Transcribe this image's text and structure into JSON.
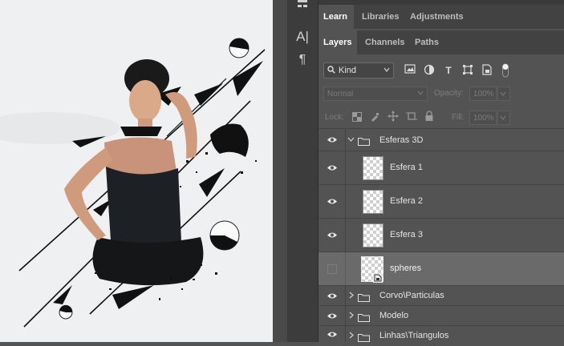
{
  "panel": {
    "top_tabs": [
      {
        "label": "Learn",
        "active": true
      },
      {
        "label": "Libraries",
        "active": false
      },
      {
        "label": "Adjustments",
        "active": false
      }
    ],
    "sub_tabs": [
      {
        "label": "Layers",
        "active": true
      },
      {
        "label": "Channels",
        "active": false
      },
      {
        "label": "Paths",
        "active": false
      }
    ],
    "filter": {
      "kind_label": "Kind",
      "icons": [
        "image-filter-icon",
        "adjustment-filter-icon",
        "type-filter-icon",
        "shape-filter-icon",
        "smart-object-filter-icon",
        "filter-toggle"
      ]
    },
    "blend": {
      "mode": "Normal",
      "opacity_label": "Opacity:",
      "opacity_value": "100%"
    },
    "lock": {
      "label": "Lock:",
      "fill_label": "Fill:",
      "fill_value": "100%"
    },
    "layers": [
      {
        "name": "Esferas 3D",
        "type": "group",
        "expanded": true,
        "visible": true
      },
      {
        "name": "Esfera 1",
        "type": "layer",
        "visible": true
      },
      {
        "name": "Esfera 2",
        "type": "layer",
        "visible": true
      },
      {
        "name": "Esfera 3",
        "type": "layer",
        "visible": true
      },
      {
        "name": "spheres",
        "type": "smart-object",
        "visible": false,
        "selected": true
      },
      {
        "name": "Corvo\\Particulas",
        "type": "group",
        "expanded": false,
        "visible": true
      },
      {
        "name": "Modelo",
        "type": "group",
        "expanded": false,
        "visible": true
      },
      {
        "name": "Linhas\\Triangulos",
        "type": "group",
        "expanded": false,
        "visible": true
      }
    ]
  },
  "toolbar": {
    "tools": [
      "character-panel-icon",
      "paragraph-panel-icon"
    ]
  },
  "colors": {
    "panel_bg": "#535353",
    "tab_bar_bg": "#424242",
    "selected_row": "#6a6a6a",
    "canvas_bg": "#eef0f1"
  }
}
